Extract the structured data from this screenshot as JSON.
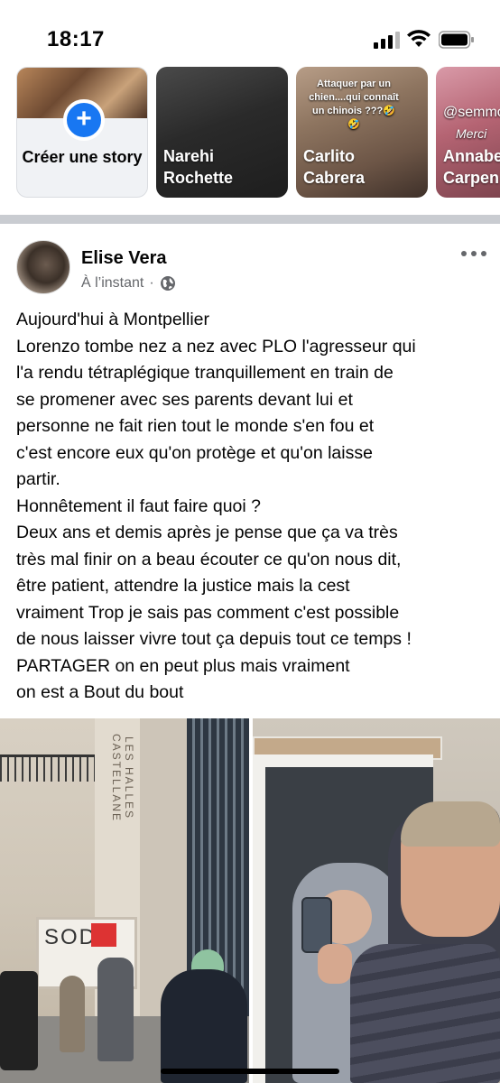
{
  "status_bar": {
    "time": "18:17",
    "icons": [
      "signal-icon",
      "wifi-icon",
      "battery-icon"
    ]
  },
  "stories": {
    "create": {
      "label": "Créer une story",
      "icon": "plus-icon"
    },
    "items": [
      {
        "name": "Narehi Rochette",
        "line1": "Narehi",
        "line2": "Rochette"
      },
      {
        "name": "Carlito Cabrera",
        "line1": "Carlito",
        "line2": "Cabrera",
        "caption": "Attaquer par un chien....qui connaît un chinois ???🤣🤣"
      },
      {
        "name": "Annabelle Carpentier",
        "line1": "Annabe",
        "line2": "Carpen",
        "caption_a": "@semmo",
        "caption_b": "Merci"
      }
    ]
  },
  "post": {
    "author": "Elise Vera",
    "time": "À l’instant",
    "separator": "·",
    "audience_icon": "globe-icon",
    "more_icon": "more-options-icon",
    "lines": [
      "Aujourd'hui à Montpellier",
      "Lorenzo tombe nez a nez avec PLO l'agresseur qui",
      "l'a rendu tétraplégique tranquillement en train de",
      "se promener avec ses parents devant lui et",
      "personne ne fait rien tout le monde s'en fou et",
      "c'est encore eux qu'on protège et qu'on laisse",
      "partir.",
      "Honnêtement il faut faire quoi ?",
      "Deux ans et demis après je pense que ça va très",
      "très mal finir on a beau écouter ce qu'on nous dit,",
      "être patient, attendre la justice mais la cest",
      "vraiment Trop je sais pas comment c'est possible",
      "de nous laisser vivre tout ça depuis tout ce temps !",
      "PARTAGER on en peut plus mais vraiment",
      "on est a Bout du bout"
    ],
    "photo_left": {
      "sign": "LES HALLES CASTELLANE",
      "shop": "SOD"
    },
    "photo_right": {}
  },
  "colors": {
    "accent": "#1877f2",
    "divider": "#c9ccd1",
    "meta": "#65676b"
  }
}
